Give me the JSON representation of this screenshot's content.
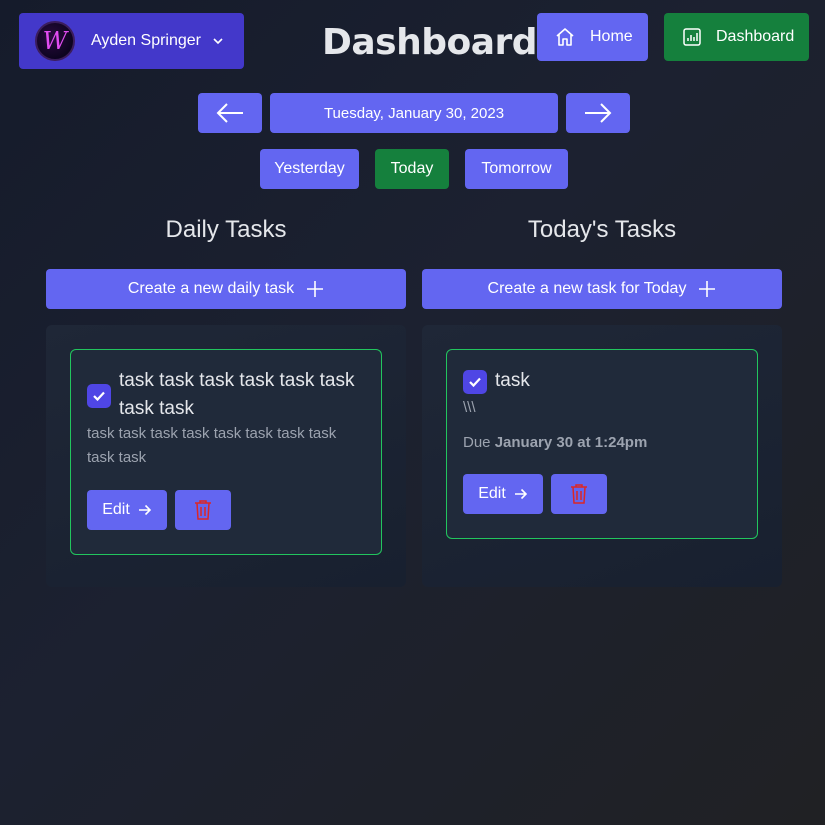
{
  "header": {
    "user_name": "Ayden Springer",
    "avatar_letter": "W",
    "title": "Dashboard",
    "home_label": "Home",
    "dashboard_label": "Dashboard"
  },
  "date_nav": {
    "current_date": "Tuesday, January 30, 2023",
    "yesterday_label": "Yesterday",
    "today_label": "Today",
    "tomorrow_label": "Tomorrow"
  },
  "daily": {
    "title": "Daily Tasks",
    "create_label": "Create a new daily task",
    "tasks": [
      {
        "title": "task task task task task task task task",
        "description": "task task task task task task task task task task",
        "edit_label": "Edit"
      }
    ]
  },
  "today": {
    "title": "Today's Tasks",
    "create_label": "Create a new task for Today",
    "tasks": [
      {
        "title": "task",
        "description": "\\\\\\",
        "due_prefix": "Due",
        "due_value": "January 30 at 1:24pm",
        "edit_label": "Edit"
      }
    ]
  },
  "colors": {
    "primary": "#6366f1",
    "user_button": "#4338ca",
    "success": "#15803d",
    "card_border": "#22c55e",
    "danger": "#dc2626"
  }
}
